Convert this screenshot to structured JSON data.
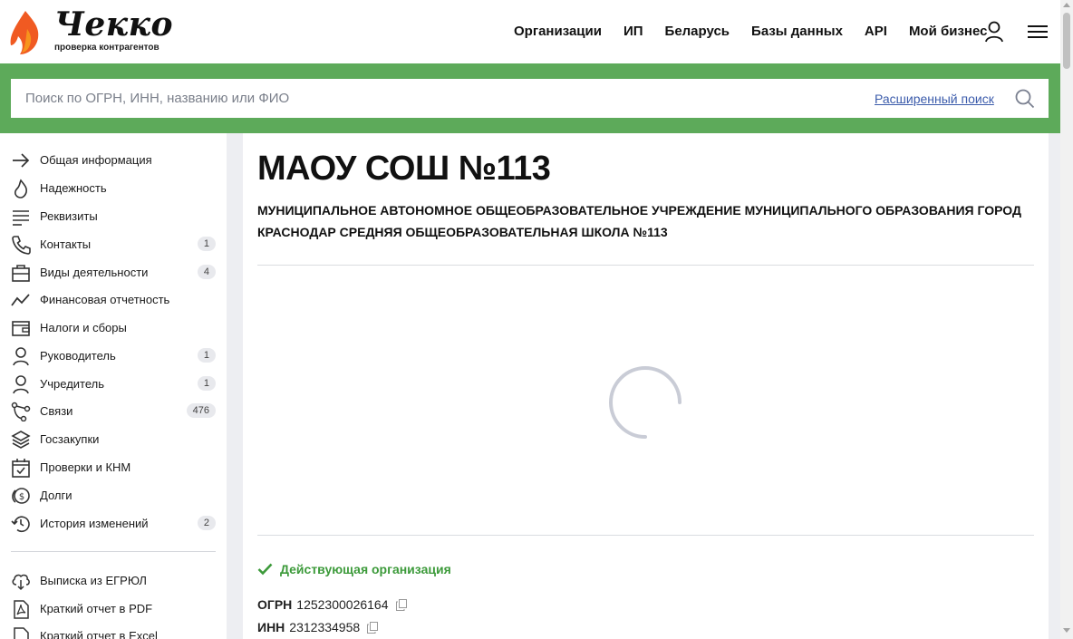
{
  "brand": {
    "name": "Чекко",
    "tagline": "проверка контрагентов"
  },
  "nav": {
    "items": [
      "Организации",
      "ИП",
      "Беларусь",
      "Базы данных",
      "API",
      "Мой бизнес"
    ],
    "user_icon": "user-icon",
    "menu_icon": "hamburger-menu-icon"
  },
  "search": {
    "placeholder": "Поиск по ОГРН, ИНН, названию или ФИО",
    "advanced_label": "Расширенный поиск",
    "icon": "search-icon"
  },
  "sidebar": {
    "items": [
      {
        "label": "Общая информация",
        "icon": "arrow-right-icon",
        "count": ""
      },
      {
        "label": "Надежность",
        "icon": "flame-icon",
        "count": ""
      },
      {
        "label": "Реквизиты",
        "icon": "lines-icon",
        "count": ""
      },
      {
        "label": "Контакты",
        "icon": "phone-icon",
        "count": "1"
      },
      {
        "label": "Виды деятельности",
        "icon": "briefcase-icon",
        "count": "4"
      },
      {
        "label": "Финансовая отчетность",
        "icon": "trend-icon",
        "count": ""
      },
      {
        "label": "Налоги и сборы",
        "icon": "wallet-icon",
        "count": ""
      },
      {
        "label": "Руководитель",
        "icon": "person-icon",
        "count": "1"
      },
      {
        "label": "Учредитель",
        "icon": "person-icon",
        "count": "1"
      },
      {
        "label": "Связи",
        "icon": "connections-icon",
        "count": "476"
      },
      {
        "label": "Госзакупки",
        "icon": "layers-icon",
        "count": ""
      },
      {
        "label": "Проверки и КНМ",
        "icon": "calendar-check-icon",
        "count": ""
      },
      {
        "label": "Долги",
        "icon": "coins-icon",
        "count": ""
      },
      {
        "label": "История изменений",
        "icon": "history-icon",
        "count": "2"
      }
    ],
    "docs": [
      {
        "label": "Выписка из ЕГРЮЛ",
        "icon": "cloud-download-icon"
      },
      {
        "label": "Краткий отчет в PDF",
        "icon": "pdf-icon"
      },
      {
        "label": "Краткий отчет в Excel",
        "icon": "excel-icon"
      }
    ]
  },
  "company": {
    "short_name": "МАОУ СОШ №113",
    "full_name": "МУНИЦИПАЛЬНОЕ АВТОНОМНОЕ ОБЩЕОБРАЗОВАТЕЛЬНОЕ УЧРЕЖДЕНИЕ МУНИЦИПАЛЬНОГО ОБРАЗОВАНИЯ ГОРОД КРАСНОДАР СРЕДНЯЯ ОБЩЕОБРАЗОВАТЕЛЬНАЯ ШКОЛА №113",
    "status": "Действующая организация",
    "ogrn_label": "ОГРН",
    "ogrn": "1252300026164",
    "inn_label": "ИНН",
    "inn": "2312334958"
  },
  "colors": {
    "accent_green": "#5daa5a",
    "status_green": "#3c9a3a",
    "link_blue": "#3b5bab",
    "logo_orange": "#f05a22"
  }
}
